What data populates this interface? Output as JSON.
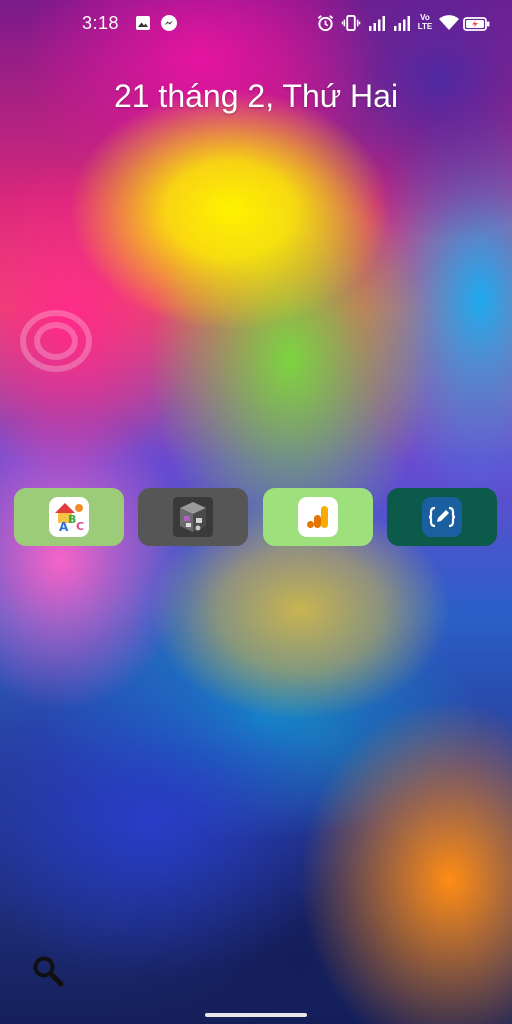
{
  "status_bar": {
    "time": "3:18",
    "left_icons": [
      "image-icon",
      "messenger-icon"
    ],
    "right_icons": [
      "alarm-icon",
      "vibrate-icon",
      "signal-icon",
      "signal-icon",
      "volte-icon",
      "wifi-icon",
      "battery-charging-icon"
    ],
    "volte_text": "Vo LTE"
  },
  "lock_screen": {
    "date": "21 tháng 2, Thứ Hai"
  },
  "apps": [
    {
      "icon": "abc-kids-app-icon",
      "tile_color": "#9ccb7a"
    },
    {
      "icon": "3d-cube-app-icon",
      "tile_color": "#565656"
    },
    {
      "icon": "analytics-app-icon",
      "tile_color": "#9ee07c"
    },
    {
      "icon": "code-editor-app-icon",
      "tile_color": "#0c5a4a"
    }
  ],
  "bottom": {
    "search_icon": "search-icon"
  },
  "colors": {
    "text": "#ffffff",
    "analytics_orange": "#f9ab00",
    "code_editor_bg": "#1a5fa0"
  }
}
